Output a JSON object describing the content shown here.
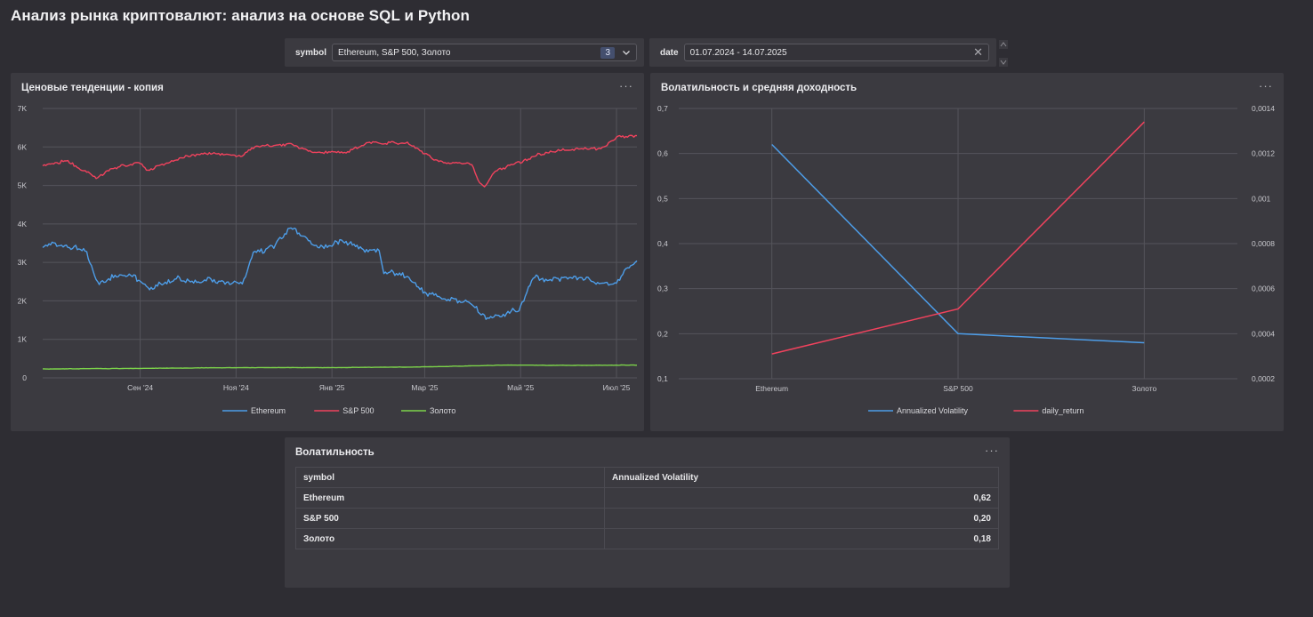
{
  "page": {
    "title": "Анализ рынка криптовалют: анализ на основе SQL и Python"
  },
  "filters": {
    "symbol": {
      "label": "symbol",
      "value": "Ethereum, S&P 500, Золото",
      "count": "3"
    },
    "date": {
      "label": "date",
      "value": "01.07.2024 - 14.07.2025"
    }
  },
  "widgets": {
    "price": {
      "title": "Ценовые тенденции - копия",
      "menu": "···"
    },
    "volatility": {
      "title": "Волатильность и средняя доходность",
      "menu": "···"
    },
    "table": {
      "title": "Волатильность",
      "menu": "···"
    }
  },
  "colors": {
    "ethereum": "#4d9de8",
    "sp500": "#f0425d",
    "gold": "#7cd34a",
    "background": "#2e2d33",
    "panel": "#3b3a40"
  },
  "chart_data": [
    {
      "type": "line",
      "title": "Ценовые тенденции - копия",
      "y_ticks": [
        "0",
        "1K",
        "2K",
        "3K",
        "4K",
        "5K",
        "6K",
        "7K"
      ],
      "ylim": [
        0,
        7000
      ],
      "x_ticks": [
        "Сен '24",
        "Ноя '24",
        "Янв '25",
        "Мар '25",
        "Май '25",
        "Июл '25"
      ],
      "x_tick_dates": [
        "2024-09-01",
        "2024-11-01",
        "2025-01-01",
        "2025-03-01",
        "2025-05-01",
        "2025-07-01"
      ],
      "x_range": [
        "2024-07-01",
        "2025-07-14"
      ],
      "grid": true,
      "legend_position": "bottom",
      "series": [
        {
          "name": "Ethereum",
          "dates": [
            "2024-07-01",
            "2024-07-10",
            "2024-07-20",
            "2024-07-29",
            "2024-08-05",
            "2024-08-15",
            "2024-08-25",
            "2024-09-06",
            "2024-09-15",
            "2024-09-27",
            "2024-10-05",
            "2024-10-15",
            "2024-10-25",
            "2024-11-05",
            "2024-11-12",
            "2024-11-25",
            "2024-12-06",
            "2024-12-10",
            "2024-12-20",
            "2024-12-31",
            "2025-01-07",
            "2025-01-20",
            "2025-01-31",
            "2025-02-03",
            "2025-02-15",
            "2025-02-28",
            "2025-03-10",
            "2025-03-20",
            "2025-04-01",
            "2025-04-09",
            "2025-04-20",
            "2025-04-30",
            "2025-05-09",
            "2025-05-20",
            "2025-06-01",
            "2025-06-15",
            "2025-06-22",
            "2025-07-01",
            "2025-07-10",
            "2025-07-14"
          ],
          "values": [
            3450,
            3450,
            3400,
            3250,
            2450,
            2650,
            2700,
            2350,
            2400,
            2600,
            2450,
            2550,
            2500,
            2450,
            3250,
            3400,
            3950,
            3750,
            3450,
            3400,
            3600,
            3300,
            3300,
            2750,
            2700,
            2250,
            2050,
            2050,
            1900,
            1550,
            1650,
            1800,
            2600,
            2550,
            2600,
            2550,
            2400,
            2500,
            2950,
            3000
          ]
        },
        {
          "name": "S&P 500",
          "dates": [
            "2024-07-01",
            "2024-07-16",
            "2024-08-05",
            "2024-08-15",
            "2024-08-31",
            "2024-09-06",
            "2024-09-30",
            "2024-10-15",
            "2024-11-05",
            "2024-11-11",
            "2024-12-06",
            "2024-12-20",
            "2025-01-10",
            "2025-01-23",
            "2025-02-19",
            "2025-03-10",
            "2025-03-31",
            "2025-04-04",
            "2025-04-08",
            "2025-04-15",
            "2025-05-01",
            "2025-05-12",
            "2025-06-01",
            "2025-06-20",
            "2025-07-03",
            "2025-07-14"
          ],
          "values": [
            5500,
            5650,
            5200,
            5450,
            5600,
            5400,
            5750,
            5850,
            5750,
            6000,
            6050,
            5850,
            5850,
            6100,
            6100,
            5600,
            5550,
            5100,
            4950,
            5400,
            5600,
            5800,
            5950,
            5950,
            6280,
            6270
          ]
        },
        {
          "name": "Золото",
          "dates": [
            "2024-07-01",
            "2024-09-01",
            "2024-11-01",
            "2025-01-01",
            "2025-03-01",
            "2025-04-20",
            "2025-06-01",
            "2025-07-14"
          ],
          "values": [
            230,
            245,
            265,
            265,
            285,
            330,
            325,
            330
          ]
        }
      ]
    },
    {
      "type": "line",
      "title": "Волатильность и средняя доходность",
      "categories": [
        "Ethereum",
        "S&P 500",
        "Золото"
      ],
      "y_left_ticks": [
        "0,1",
        "0,2",
        "0,3",
        "0,4",
        "0,5",
        "0,6",
        "0,7"
      ],
      "ylim_left": [
        0.1,
        0.7
      ],
      "y_right_ticks": [
        "0,0002",
        "0,0004",
        "0,0006",
        "0,0008",
        "0,001",
        "0,0012",
        "0,0014"
      ],
      "ylim_right": [
        0.0002,
        0.0014
      ],
      "grid": true,
      "legend_position": "bottom",
      "series": [
        {
          "name": "Annualized Volatility",
          "axis": "left",
          "values": [
            0.62,
            0.2,
            0.18
          ]
        },
        {
          "name": "daily_return",
          "axis": "right",
          "values": [
            0.00031,
            0.00051,
            0.00134
          ]
        }
      ]
    },
    {
      "type": "table",
      "title": "Волатильность",
      "columns": [
        "symbol",
        "Annualized Volatility"
      ],
      "rows": [
        [
          "Ethereum",
          "0,62"
        ],
        [
          "S&P 500",
          "0,20"
        ],
        [
          "Золото",
          "0,18"
        ]
      ]
    }
  ]
}
